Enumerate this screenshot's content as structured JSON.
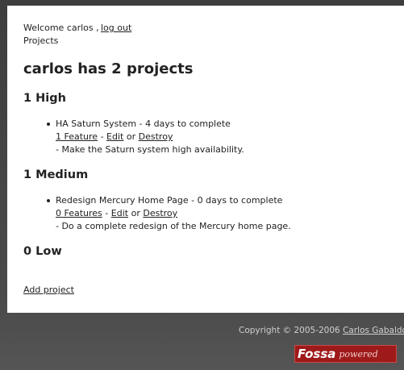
{
  "header": {
    "welcome": "Welcome carlos ,",
    "logout": "log out",
    "breadcrumb": "Projects"
  },
  "main": {
    "title": "carlos has 2 projects",
    "groups": [
      {
        "heading": "1 High",
        "projects": [
          {
            "name": "HA Saturn System - 4 days to complete",
            "features": "1 Feature",
            "sep1": "-",
            "edit": "Edit",
            "or": "or",
            "destroy": "Destroy",
            "description": "- Make the Saturn system high availability."
          }
        ]
      },
      {
        "heading": "1 Medium",
        "projects": [
          {
            "name": "Redesign Mercury Home Page - 0 days to complete",
            "features": "0 Features",
            "sep1": "-",
            "edit": "Edit",
            "or": "or",
            "destroy": "Destroy",
            "description": "- Do a complete redesign of the Mercury home page."
          }
        ]
      },
      {
        "heading": "0 Low",
        "projects": []
      }
    ],
    "add_project": "Add project"
  },
  "footer": {
    "copyright": "Copyright © 2005-2006",
    "author": "Carlos Gabaldon",
    "pipe": "|",
    "badge_brand": "Fossa",
    "badge_powered": "powered"
  }
}
